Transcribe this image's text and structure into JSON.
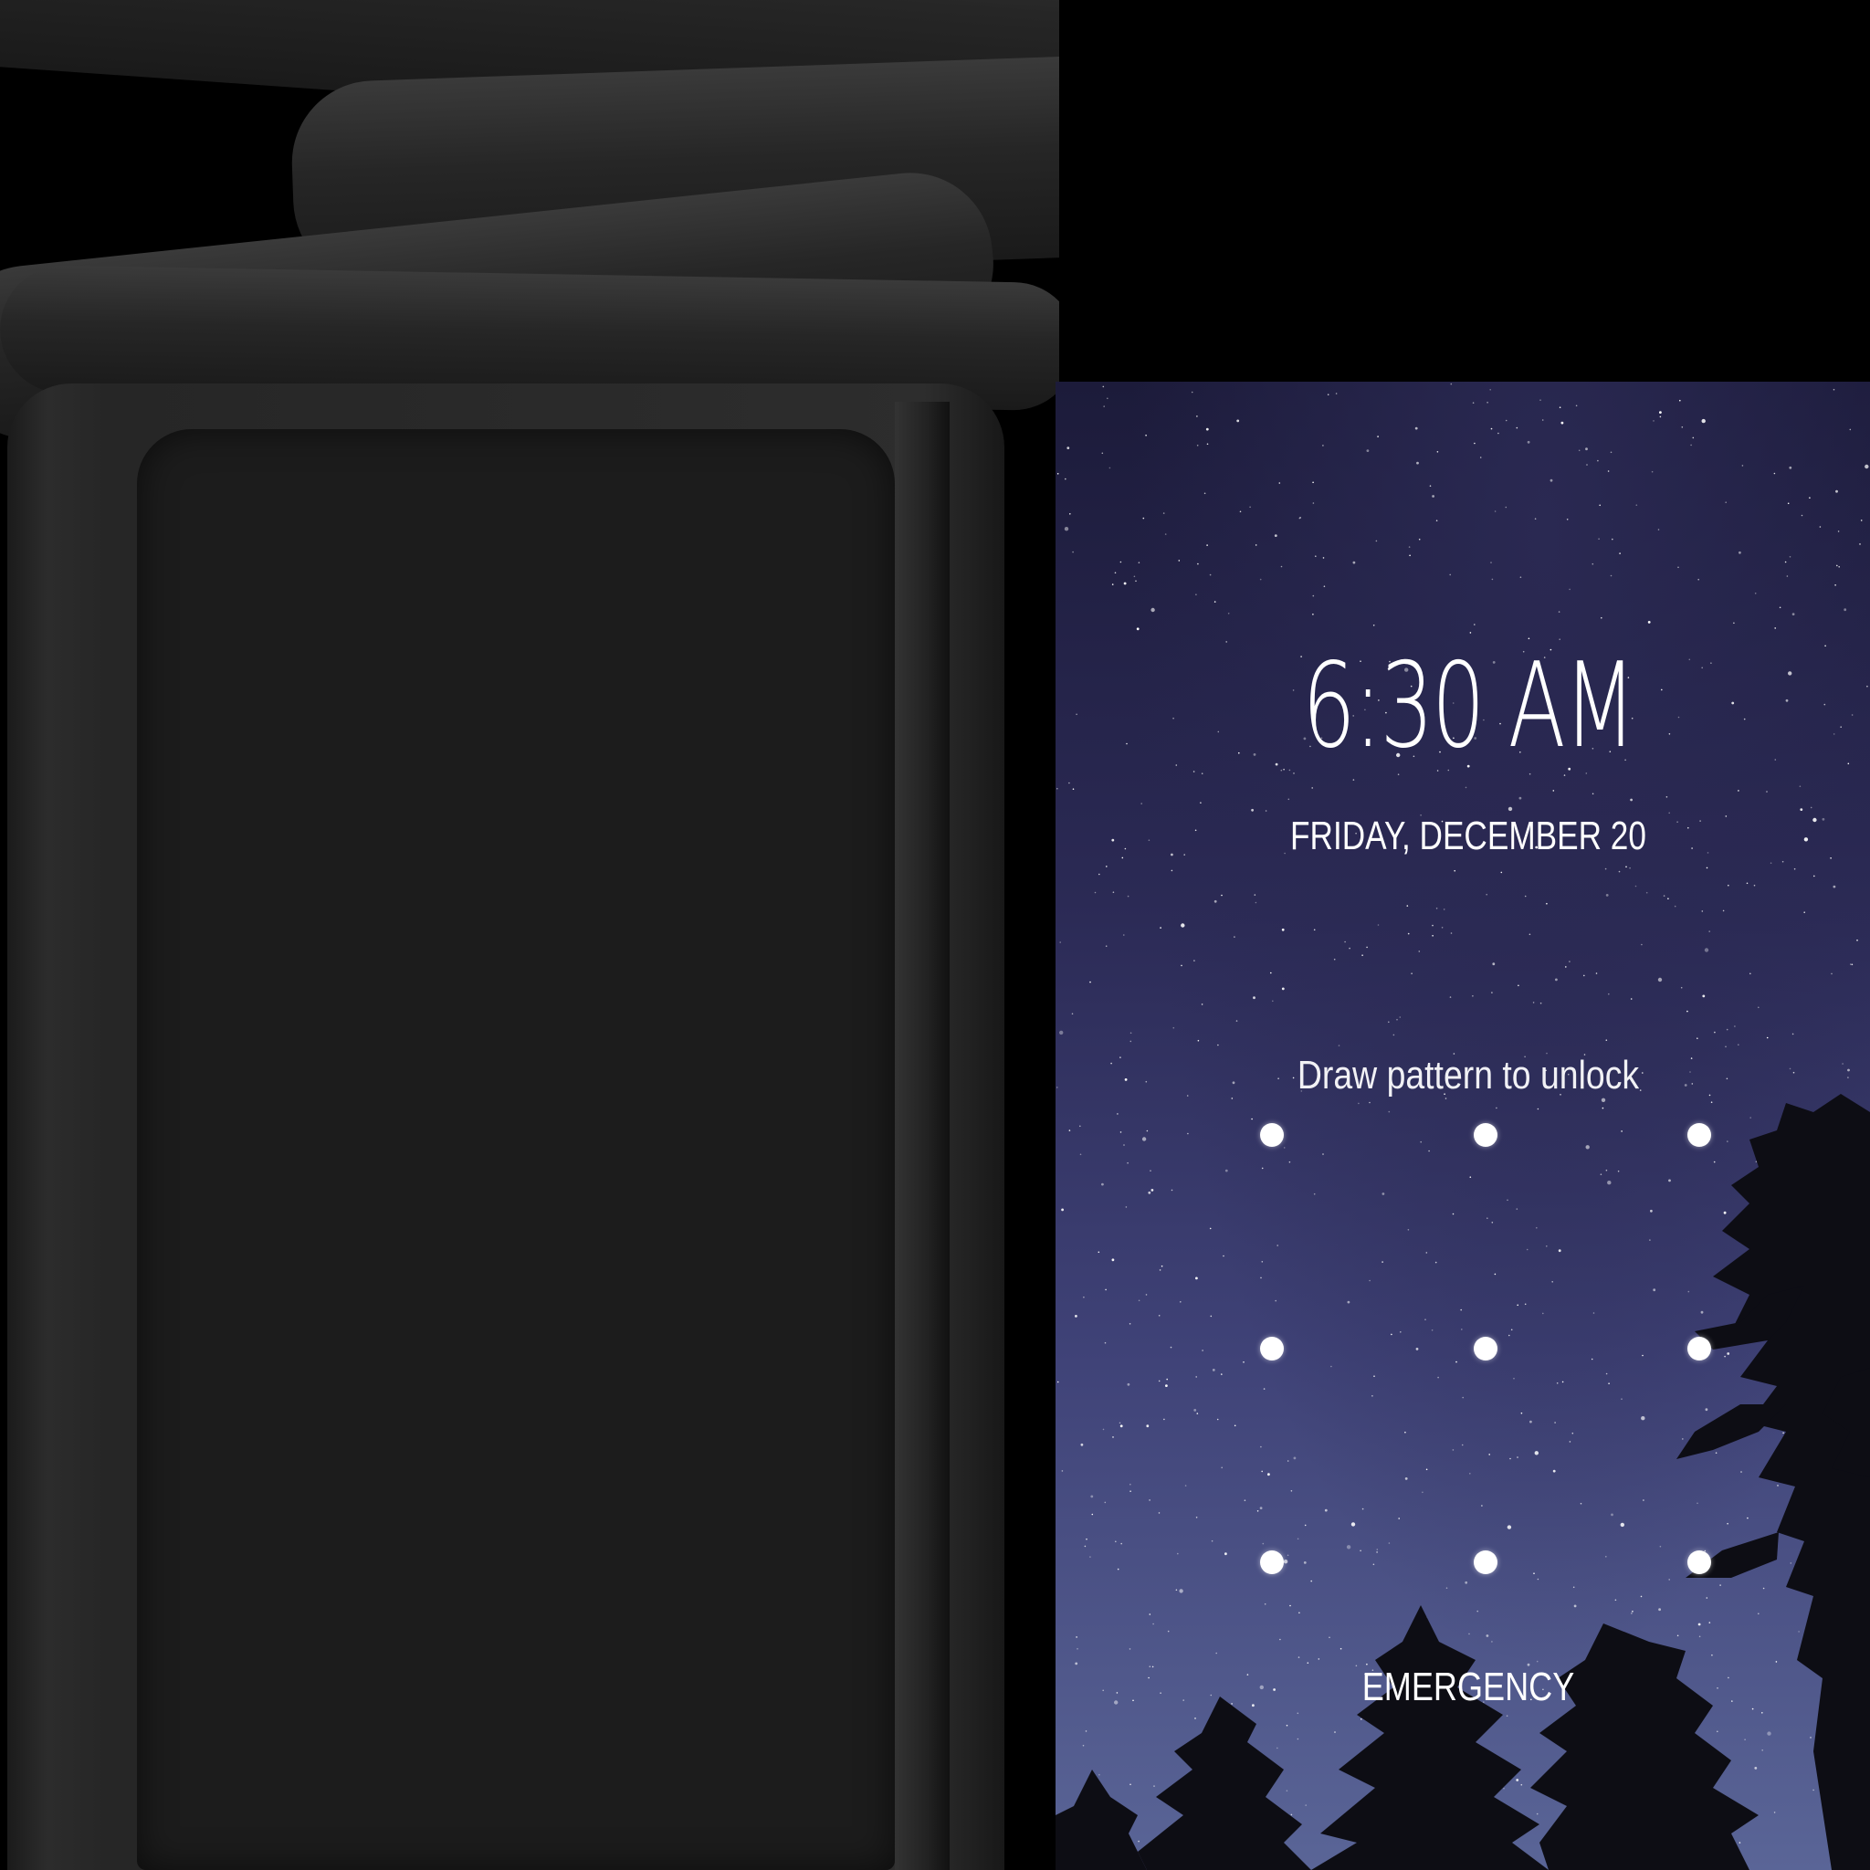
{
  "lock_screen": {
    "time": "6:30 AM",
    "date": "FRIDAY, DECEMBER 20",
    "unlock_hint": "Draw pattern to unlock",
    "emergency_label": "EMERGENCY",
    "pattern_rows": 3,
    "pattern_cols": 3,
    "wallpaper": "starry-night-sky-with-pine-tree-silhouettes",
    "colors": {
      "sky_top": "#1c1b3a",
      "sky_bottom": "#5a6597",
      "text": "#ffffff"
    }
  },
  "left_device": {
    "screen_state": "off",
    "color": "#1c1c1c"
  }
}
